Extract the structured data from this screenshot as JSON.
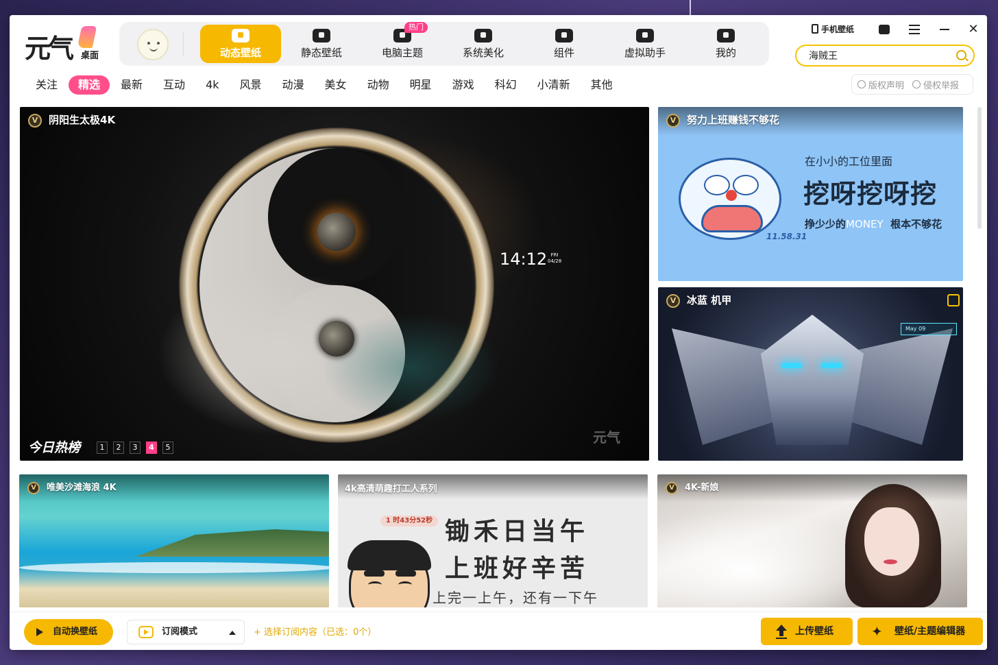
{
  "app": {
    "logo_text": "元气",
    "logo_sub": "桌面"
  },
  "nav": {
    "items": [
      {
        "label": "动态壁纸",
        "icon": "video-play-icon",
        "active": true
      },
      {
        "label": "静态壁纸",
        "icon": "image-icon"
      },
      {
        "label": "电脑主题",
        "icon": "monitor-icon",
        "badge": "热门"
      },
      {
        "label": "系统美化",
        "icon": "flower-icon"
      },
      {
        "label": "组件",
        "icon": "widget-icon"
      },
      {
        "label": "虚拟助手",
        "icon": "paw-icon"
      },
      {
        "label": "我的",
        "icon": "user-face-icon"
      }
    ]
  },
  "top_actions": {
    "phone_wallpaper": "手机壁纸"
  },
  "search": {
    "value": "海贼王"
  },
  "categories": [
    "关注",
    "精选",
    "最新",
    "互动",
    "4k",
    "风景",
    "动漫",
    "美女",
    "动物",
    "明星",
    "游戏",
    "科幻",
    "小清新",
    "其他"
  ],
  "active_category": "精选",
  "legal": {
    "copyright": "版权声明",
    "report": "侵权举报"
  },
  "hero": {
    "title": "阴阳生太极4K",
    "badge": "V",
    "clock_time": "14:12",
    "clock_day": "FRI",
    "clock_date": "04/28",
    "watermark": "元气",
    "rank_label": "今日热榜",
    "pages": [
      "1",
      "2",
      "3",
      "4",
      "5"
    ],
    "current_page": 4
  },
  "cards": {
    "dora": {
      "title": "努力上班赚钱不够花",
      "line1": "在小小的工位里面",
      "line2": "挖呀挖呀挖",
      "line3_a": "挣少少的",
      "line3_b": "MONEY",
      "line3_c": "根本不够花",
      "time": "11.58.31"
    },
    "mecha": {
      "title": "冰蓝 机甲",
      "hud": "May 09"
    },
    "beach": {
      "title": "唯美沙滩海浪 4K"
    },
    "worker": {
      "title": "4k高清萌趣打工人系列",
      "time": "1 时43分52秒",
      "line1": "锄禾日当午",
      "line2": "上班好辛苦",
      "line3": "上完一上午，还有一下午"
    },
    "bride": {
      "title": "4K-新娘"
    }
  },
  "bottom": {
    "auto_switch": "自动换壁纸",
    "subscribe_mode": "订阅模式",
    "choose_subscription": "+ 选择订阅内容（已选：0个）",
    "upload": "上传壁纸",
    "editor": "壁纸/主题编辑器"
  },
  "colors": {
    "accent_yellow": "#f6b800",
    "accent_pink": "#ff4f8b"
  }
}
